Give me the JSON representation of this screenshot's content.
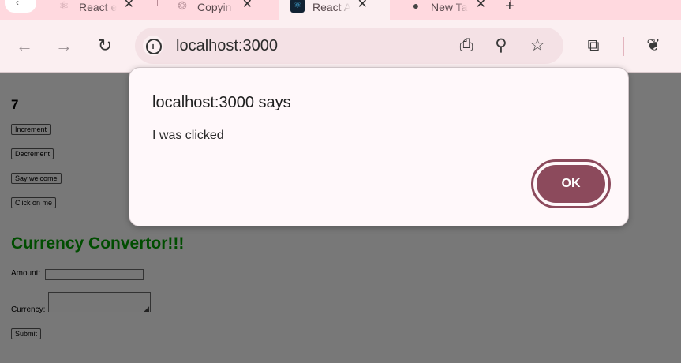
{
  "tabs": [
    {
      "label": "React e"
    },
    {
      "label": "Copyin"
    },
    {
      "label": "React A"
    },
    {
      "label": "New Ta"
    }
  ],
  "toolbar": {
    "url": "localhost:3000"
  },
  "page": {
    "count": "7",
    "buttons": {
      "increment": "Increment",
      "decrement": "Decrement",
      "say_welcome": "Say welcome",
      "click_on_me": "Click on me",
      "submit": "Submit"
    },
    "heading": "Currency Convertor!!!",
    "amount_label": "Amount:",
    "currency_label": "Currency:"
  },
  "dialog": {
    "title": "localhost:3000 says",
    "message": "I was clicked",
    "ok_label": "OK"
  },
  "colors": {
    "accent": "#8c4a5c",
    "heading_green": "#004d00",
    "tabstrip": "#ffd9df",
    "toolbar": "#fbeff1"
  }
}
